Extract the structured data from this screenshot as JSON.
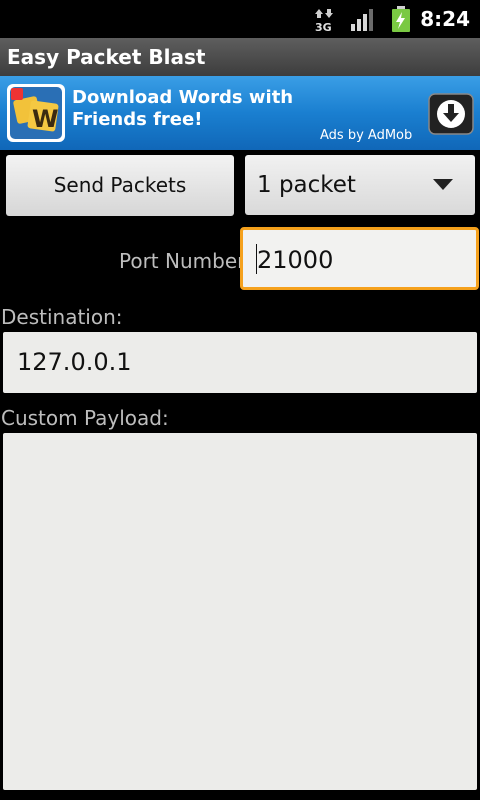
{
  "status_bar": {
    "network_type": "3G",
    "time": "8:24",
    "icons": [
      "network-3g-icon",
      "signal-strength-icon",
      "battery-charging-icon"
    ]
  },
  "app": {
    "title": "Easy Packet Blast"
  },
  "ad": {
    "headline": "Download Words with Friends free!",
    "attribution": "Ads by AdMob",
    "app_icon": "words-with-friends-icon",
    "download_icon": "download-icon",
    "background_color": "#1a7fd0"
  },
  "controls": {
    "send_button_label": "Send Packets",
    "packet_count_selected": "1 packet",
    "port_label": "Port Number",
    "port_value": "21000",
    "destination_label": "Destination:",
    "destination_value": "127.0.0.1",
    "payload_label": "Custom Payload:",
    "payload_value": ""
  },
  "colors": {
    "focus_border": "#f5a11c",
    "background": "#000000",
    "label_text": "#bdbdbd"
  }
}
